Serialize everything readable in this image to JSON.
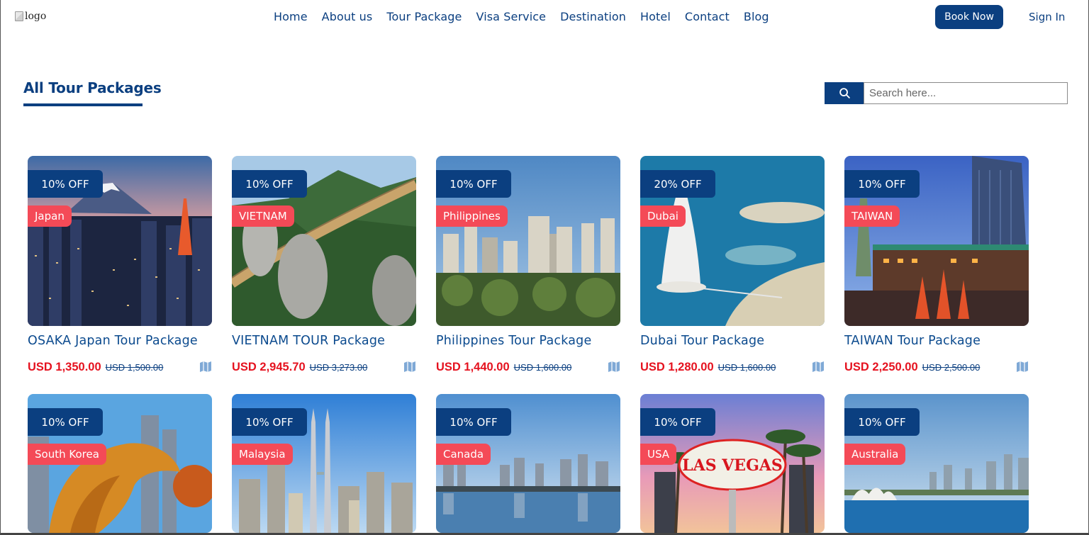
{
  "header": {
    "logo_alt": "logo",
    "nav": [
      "Home",
      "About us",
      "Tour Package",
      "Visa Service",
      "Destination",
      "Hotel",
      "Contact",
      "Blog"
    ],
    "book_now": "Book Now",
    "sign_in": "Sign In"
  },
  "main": {
    "title": "All Tour Packages",
    "search": {
      "placeholder": "Search here..."
    }
  },
  "cards": [
    {
      "discount": "10% OFF",
      "country": "Japan",
      "title": "OSAKA Japan Tour Package",
      "price": "USD 1,350.00",
      "old_price": "USD 1,500.00"
    },
    {
      "discount": "10% OFF",
      "country": "VIETNAM",
      "title": "VIETNAM TOUR Package",
      "price": "USD 2,945.70",
      "old_price": "USD 3,273.00"
    },
    {
      "discount": "10% OFF",
      "country": "Philippines",
      "title": "Philippines Tour Package",
      "price": "USD 1,440.00",
      "old_price": "USD 1,600.00"
    },
    {
      "discount": "20% OFF",
      "country": "Dubai",
      "title": "Dubai Tour Package",
      "price": "USD 1,280.00",
      "old_price": "USD 1,600.00"
    },
    {
      "discount": "10% OFF",
      "country": "TAIWAN",
      "title": "TAIWAN Tour Package",
      "price": "USD 2,250.00",
      "old_price": "USD 2,500.00"
    },
    {
      "discount": "10% OFF",
      "country": "South Korea"
    },
    {
      "discount": "10% OFF",
      "country": "Malaysia"
    },
    {
      "discount": "10% OFF",
      "country": "Canada"
    },
    {
      "discount": "10% OFF",
      "country": "USA",
      "sign_text": "LAS VEGAS"
    },
    {
      "discount": "10% OFF",
      "country": "Australia"
    }
  ],
  "colors": {
    "brand": "#0b3f80",
    "badge": "#f44a57",
    "price": "#e5121f"
  },
  "icons": {
    "search": "search-icon",
    "map": "map-icon"
  }
}
